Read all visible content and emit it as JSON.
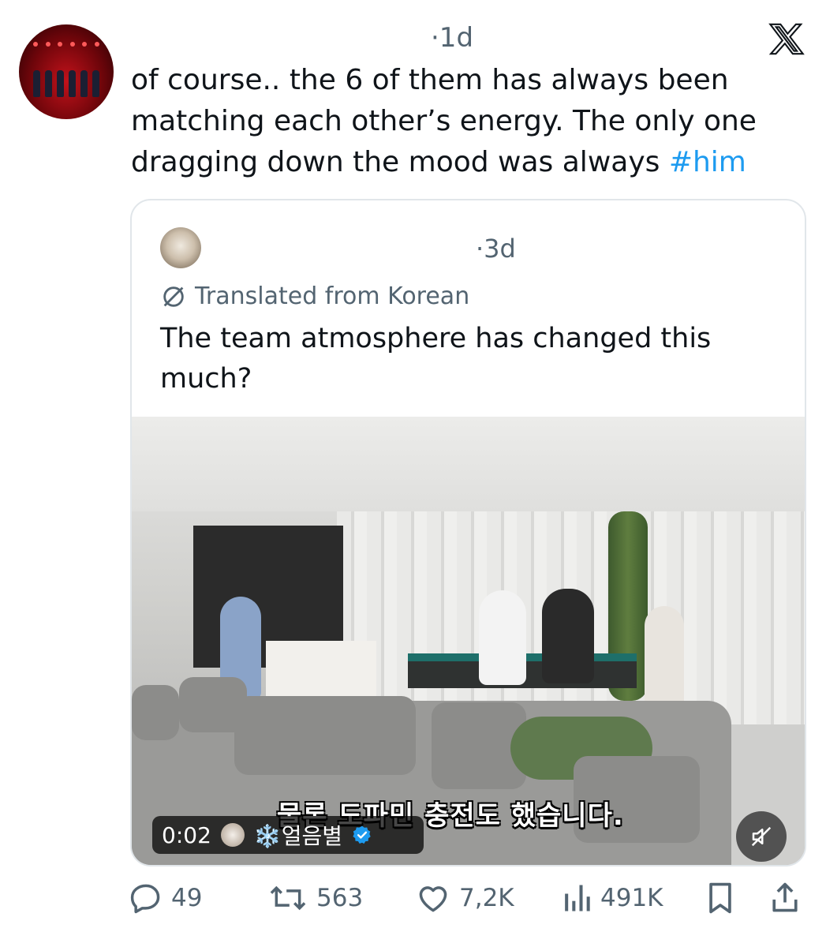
{
  "post": {
    "time": "·1d",
    "text_before": "of course.. the 6 of them has always been matching each other’s energy. The only one dragging down the mood was always ",
    "hashtag": "#him"
  },
  "quote": {
    "time": "·3d",
    "translated_label": "Translated from Korean",
    "text": "The team atmosphere has changed this much?",
    "video": {
      "timestamp": "0:02",
      "channel_name": "❄️얼음별",
      "subtitle": "물론 도파민 충전도 했습니다."
    }
  },
  "actions": {
    "replies": "49",
    "reposts": "563",
    "likes": "7,2K",
    "views": "491K"
  },
  "icons": {
    "brand": "x-logo-icon",
    "translate": "globe-slash-icon",
    "verified": "verified-badge-icon",
    "mute": "speaker-muted-icon",
    "reply": "reply-icon",
    "repost": "repost-icon",
    "like": "heart-icon",
    "views": "views-bar-chart-icon",
    "bookmark": "bookmark-icon",
    "share": "share-icon"
  },
  "colors": {
    "link": "#1d9bf0",
    "secondary_text": "#536471",
    "primary_text": "#0f1419",
    "verified": "#1d9bf0"
  }
}
